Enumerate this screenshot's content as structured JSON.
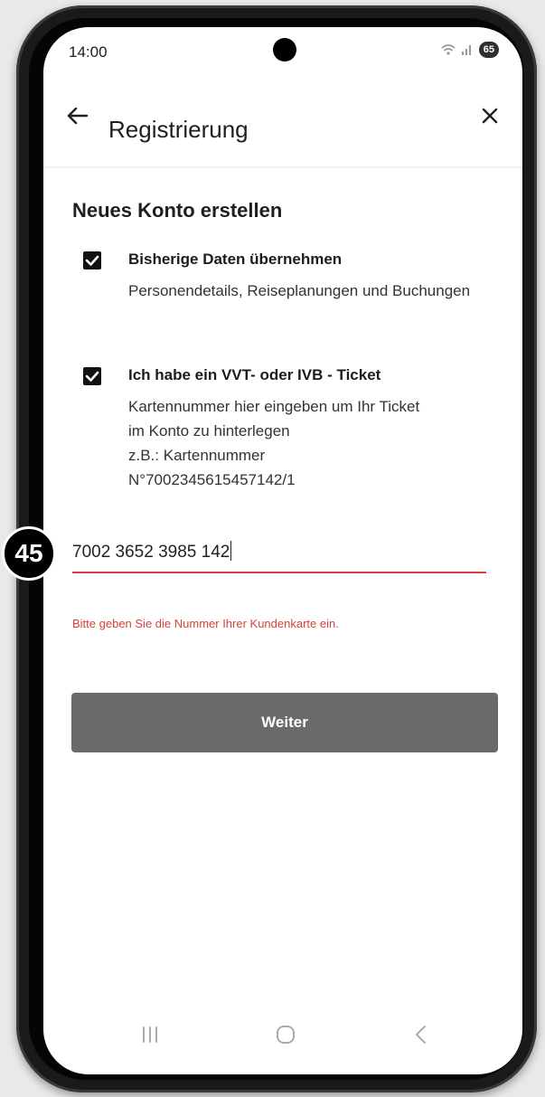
{
  "status_bar": {
    "time": "14:00",
    "battery": "65"
  },
  "app_bar": {
    "title": "Registrierung"
  },
  "form": {
    "heading": "Neues Konto erstellen",
    "options": [
      {
        "title": "Bisherige Daten übernehmen",
        "description": "Personendetails, Reiseplanungen und Buchungen",
        "checked": true
      },
      {
        "title": "Ich habe ein VVT- oder IVB - Ticket",
        "description_lines": [
          "Kartennummer hier eingeben um Ihr Ticket",
          "im Konto zu hinterlegen",
          "z.B.: Kartennummer",
          "N°7002345615457142/1"
        ],
        "checked": true
      }
    ],
    "card_number_value": "7002 3652 3985 142",
    "error_message": "Bitte geben Sie die Nummer Ihrer Kundenkarte ein.",
    "submit_label": "Weiter"
  },
  "step_badge": "45",
  "colors": {
    "error": "#d9403b",
    "button": "#6a6a6a"
  },
  "icons": {
    "back": "arrow-left",
    "close": "x",
    "nav_recents": "three-bars",
    "nav_home": "rounded-square",
    "nav_back": "chevron-left"
  }
}
